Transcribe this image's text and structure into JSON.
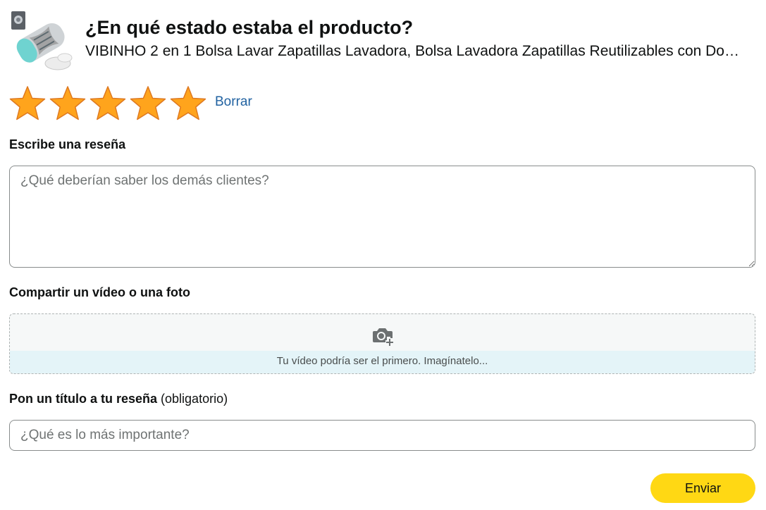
{
  "header": {
    "title": "¿En qué estado estaba el producto?",
    "product_name": "VIBINHO 2 en 1 Bolsa Lavar Zapatillas Lavadora, Bolsa Lavadora Zapatillas Reutilizables con Do…"
  },
  "rating": {
    "value": 5,
    "max": 5,
    "star_color": "#ffa41c",
    "star_stroke": "#de7921",
    "clear_label": "Borrar"
  },
  "review": {
    "label": "Escribe una reseña",
    "value": "",
    "placeholder": "¿Qué deberían saber los demás clientes?"
  },
  "media": {
    "label": "Compartir un vídeo o una foto",
    "icon": "camera-add-icon",
    "prompt": "Tu vídeo podría ser el primero. Imagínatelo..."
  },
  "review_title": {
    "label": "Pon un título a tu reseña",
    "optional_note": "(obligatorio)",
    "value": "",
    "placeholder": "¿Qué es lo más importante?"
  },
  "submit": {
    "label": "Enviar",
    "color": "#ffd814"
  }
}
